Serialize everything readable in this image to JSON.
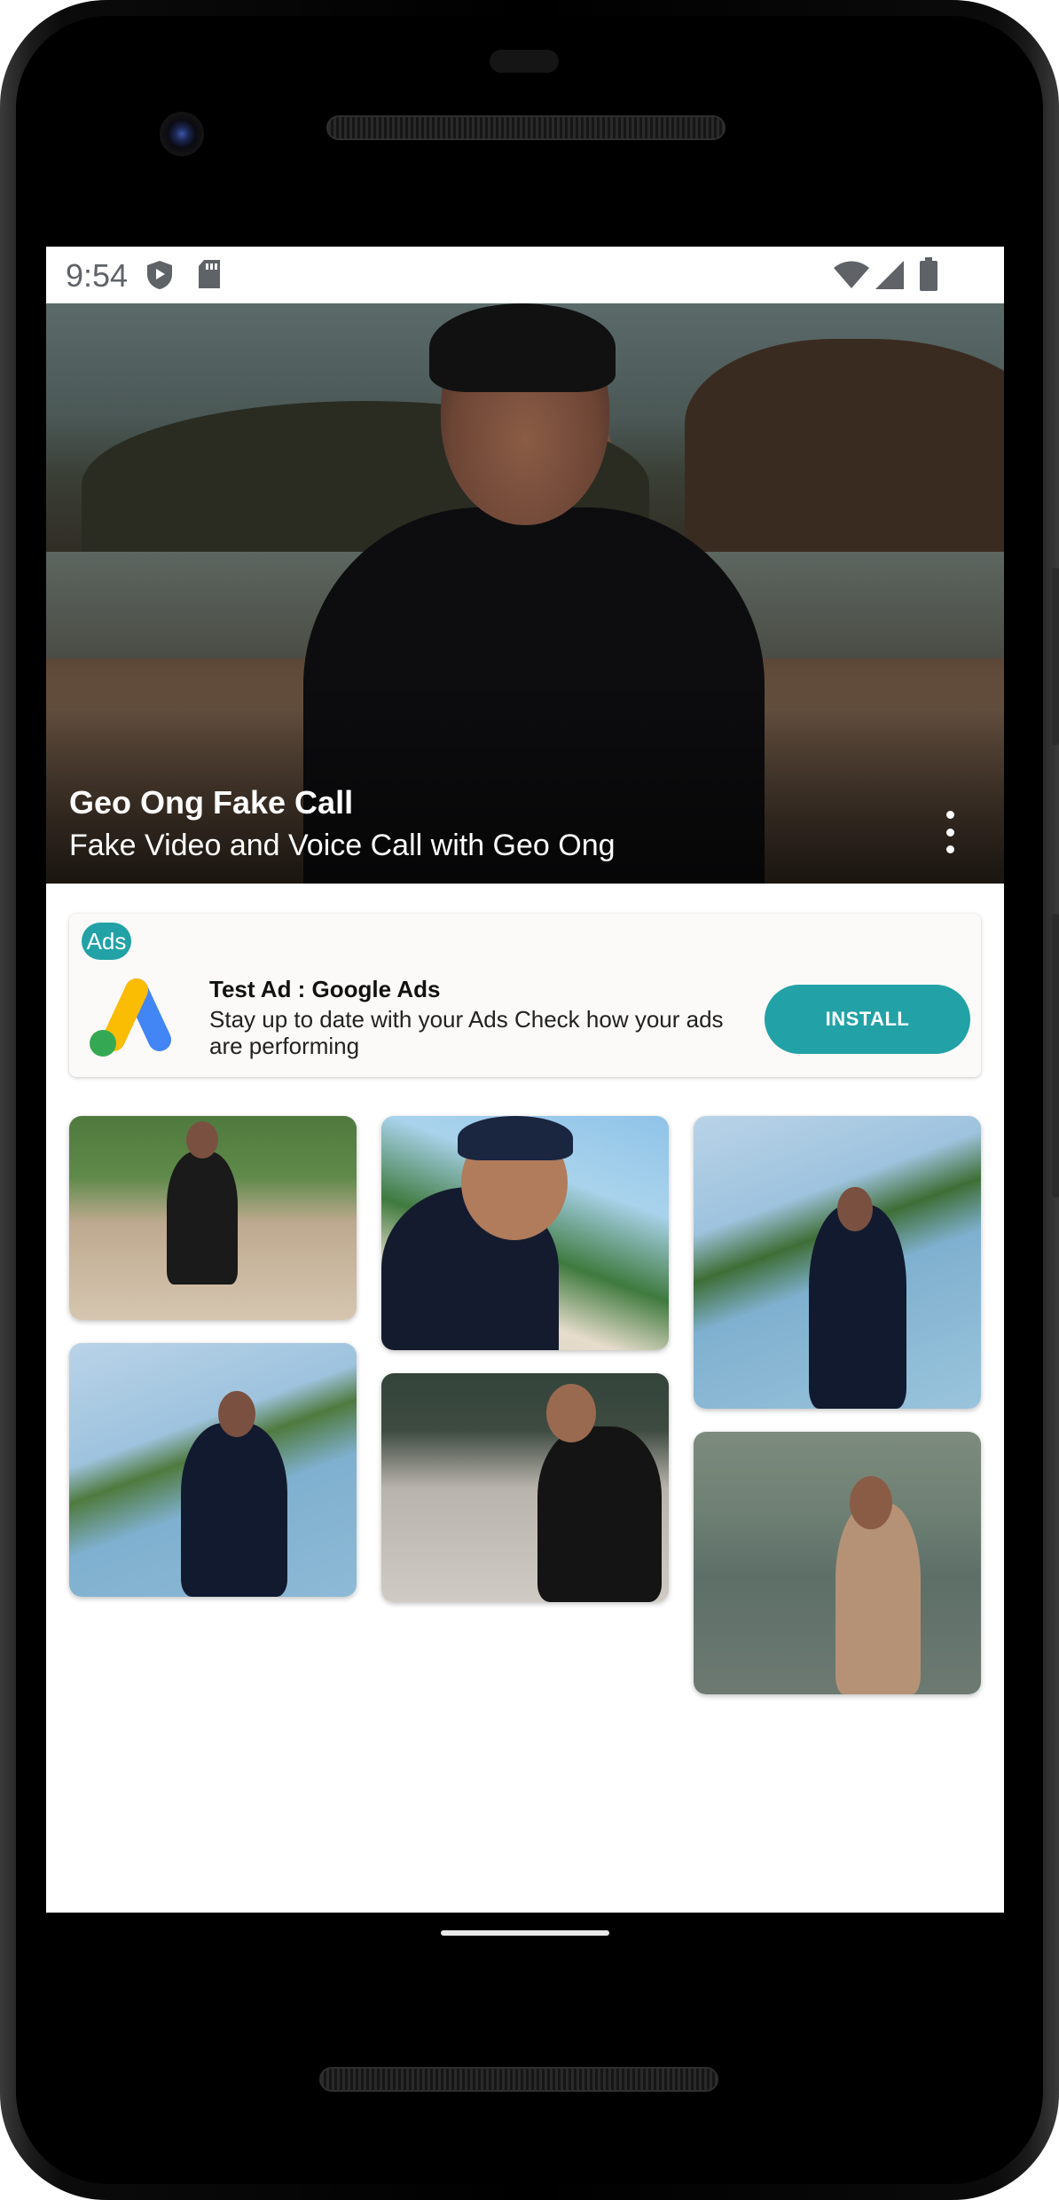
{
  "status_bar": {
    "time": "9:54"
  },
  "header": {
    "title": "Geo Ong Fake Call",
    "subtitle": "Fake Video and Voice Call with Geo Ong",
    "menu_icon": "more-vert-icon"
  },
  "ad": {
    "badge": "Ads",
    "title": "Test Ad : Google Ads",
    "description": "Stay up to date with your Ads Check how your ads are performing",
    "install_label": "INSTALL",
    "accent_color": "#22a2a6"
  },
  "gallery": {
    "columns": 3,
    "photos": [
      {
        "scene": "beach-walk"
      },
      {
        "scene": "selfie-hut"
      },
      {
        "scene": "palm-railing"
      },
      {
        "scene": "palm-railing-2"
      },
      {
        "scene": "sand-shirt"
      },
      {
        "scene": "sunset-shore"
      }
    ]
  }
}
